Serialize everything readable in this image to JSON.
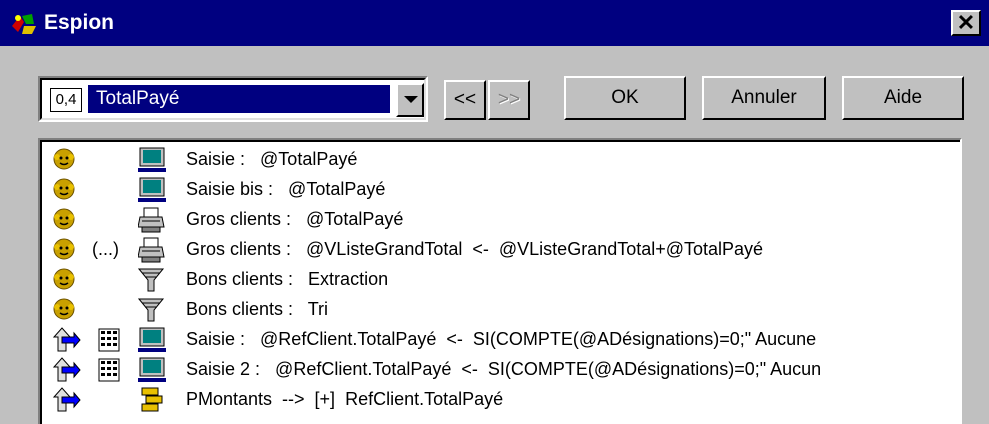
{
  "window": {
    "title": "Espion",
    "close_glyph": "✕"
  },
  "combo": {
    "type_badge": "0,4",
    "value": "TotalPayé"
  },
  "toolbar": {
    "prev_label": "<<",
    "next_label": ">>",
    "ok_label": "OK",
    "cancel_label": "Annuler",
    "help_label": "Aide"
  },
  "rows": [
    {
      "text": "Saisie :   @TotalPayé",
      "lead": "face-icon",
      "mid": "",
      "kind": "monitor-icon",
      "ellipsis": ""
    },
    {
      "text": "Saisie bis :   @TotalPayé",
      "lead": "face-icon",
      "mid": "",
      "kind": "monitor-icon",
      "ellipsis": ""
    },
    {
      "text": "Gros clients :   @TotalPayé",
      "lead": "face-icon",
      "mid": "",
      "kind": "printer-icon",
      "ellipsis": ""
    },
    {
      "text": "Gros clients :   @VListeGrandTotal  <-  @VListeGrandTotal+@TotalPayé",
      "lead": "face-icon",
      "mid": "",
      "kind": "printer-icon",
      "ellipsis": "(...)"
    },
    {
      "text": "Bons clients :   Extraction",
      "lead": "face-icon",
      "mid": "",
      "kind": "funnel-icon",
      "ellipsis": ""
    },
    {
      "text": "Bons clients :   Tri",
      "lead": "face-icon",
      "mid": "",
      "kind": "funnel-icon",
      "ellipsis": ""
    },
    {
      "text": "Saisie :   @RefClient.TotalPayé  <-  SI(COMPTE(@ADésignations)=0;\" Aucune",
      "lead": "up-arrow-icon",
      "mid": "calculator-icon",
      "kind": "monitor-icon",
      "ellipsis": ""
    },
    {
      "text": "Saisie 2 :   @RefClient.TotalPayé  <-  SI(COMPTE(@ADésignations)=0;\" Aucun",
      "lead": "up-arrow-icon",
      "mid": "calculator-icon",
      "kind": "monitor-icon",
      "ellipsis": ""
    },
    {
      "text": "PMontants  -->  [+]  RefClient.TotalPayé",
      "lead": "up-arrow-icon",
      "mid": "",
      "kind": "procedure-icon",
      "ellipsis": ""
    }
  ],
  "colors": {
    "titlebar": "#000080",
    "face": "#c8a000",
    "arrow": "#0000ff",
    "monitor": "#008080"
  }
}
